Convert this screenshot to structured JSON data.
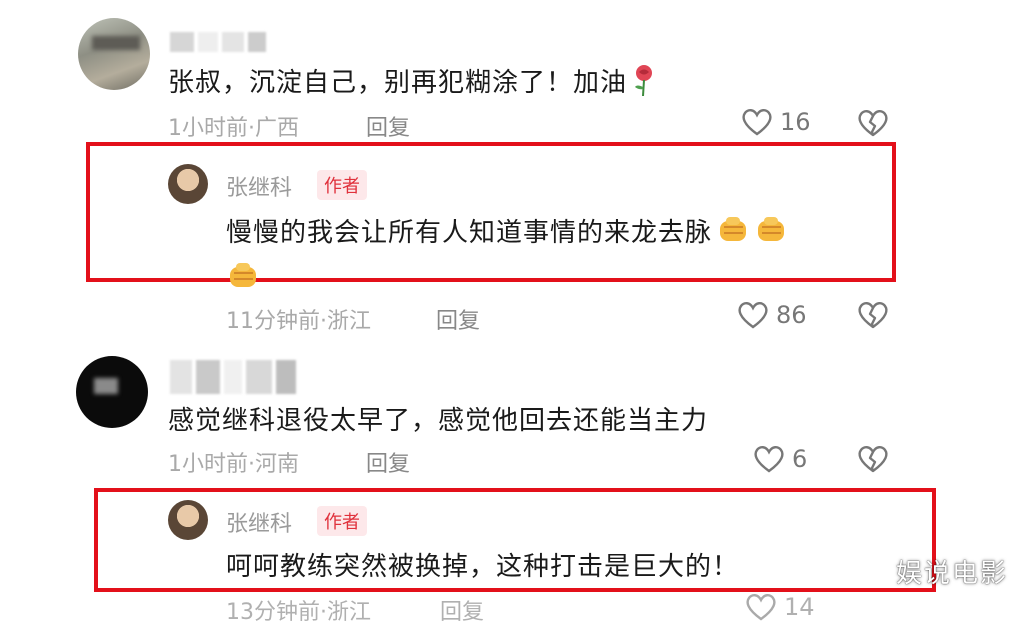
{
  "comments": [
    {
      "text": "张叔，沉淀自己，别再犯糊涂了！加油",
      "time_location": "1小时前·广西",
      "reply_label": "回复",
      "likes": "16",
      "reply": {
        "author": "张继科",
        "badge": "作者",
        "text_line1": "慢慢的我会让所有人知道事情的来龙去脉",
        "time_location": "11分钟前·浙江",
        "reply_label": "回复",
        "likes": "86"
      }
    },
    {
      "text": "感觉继科退役太早了，感觉他回去还能当主力",
      "time_location": "1小时前·河南",
      "reply_label": "回复",
      "likes": "6",
      "reply": {
        "author": "张继科",
        "badge": "作者",
        "text_line1": "呵呵教练突然被换掉，这种打击是巨大的！",
        "time_location": "13分钟前·浙江",
        "reply_label": "回复",
        "likes": "14"
      }
    }
  ],
  "watermark": "娱说电影",
  "colors": {
    "highlight_border": "#e3101a",
    "badge_bg": "#fde8ea",
    "badge_text": "#e0313c",
    "meta_text": "#a9a9a9"
  },
  "icons": {
    "like": "heart-outline-icon",
    "dislike": "broken-heart-icon",
    "emoji_comment1": "rose-emoji",
    "emoji_reply1": "raised-fist-emoji"
  }
}
